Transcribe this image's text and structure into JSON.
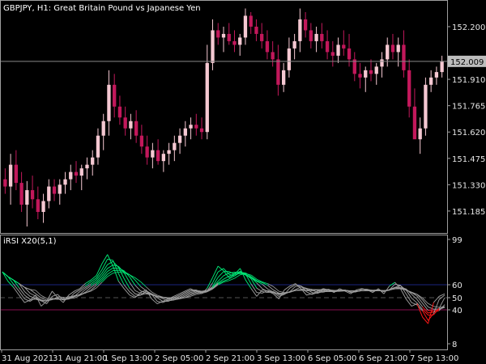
{
  "chart_data": [
    {
      "type": "candlestick",
      "title": "GBPJPY, H1:  Great Britain Pound vs Japanese Yen",
      "ylim": [
        151.1,
        152.32
      ],
      "y_ticks": [
        "152.200",
        "151.910",
        "151.765",
        "151.620",
        "151.475",
        "151.330",
        "151.185"
      ],
      "y_tick_values": [
        152.2,
        151.91,
        151.765,
        151.62,
        151.475,
        151.33,
        151.185
      ],
      "current_price": "152.009",
      "current_price_value": 152.009,
      "colors": {
        "bull": "#f5c8d2",
        "bear": "#c2185b",
        "price_line": "#888888",
        "price_label_bg": "#bdbdbd"
      },
      "candles": [
        [
          151.36,
          151.42,
          151.28,
          151.32
        ],
        [
          151.32,
          151.5,
          151.22,
          151.44
        ],
        [
          151.44,
          151.52,
          151.3,
          151.34
        ],
        [
          151.34,
          151.4,
          151.18,
          151.22
        ],
        [
          151.22,
          151.35,
          151.1,
          151.3
        ],
        [
          151.3,
          151.38,
          151.2,
          151.25
        ],
        [
          151.25,
          151.32,
          151.14,
          151.18
        ],
        [
          151.18,
          151.28,
          151.12,
          151.24
        ],
        [
          151.24,
          151.36,
          151.2,
          151.32
        ],
        [
          151.32,
          151.36,
          151.24,
          151.28
        ],
        [
          151.28,
          151.36,
          151.22,
          151.33
        ],
        [
          151.33,
          151.4,
          151.28,
          151.36
        ],
        [
          151.36,
          151.44,
          151.3,
          151.4
        ],
        [
          151.4,
          151.46,
          151.34,
          151.38
        ],
        [
          151.38,
          151.44,
          151.3,
          151.42
        ],
        [
          151.42,
          151.48,
          151.36,
          151.44
        ],
        [
          151.44,
          151.52,
          151.38,
          151.48
        ],
        [
          151.48,
          151.64,
          151.44,
          151.6
        ],
        [
          151.6,
          151.72,
          151.52,
          151.68
        ],
        [
          151.68,
          151.96,
          151.6,
          151.88
        ],
        [
          151.88,
          151.94,
          151.7,
          151.76
        ],
        [
          151.76,
          151.82,
          151.66,
          151.7
        ],
        [
          151.7,
          151.76,
          151.6,
          151.64
        ],
        [
          151.64,
          151.72,
          151.58,
          151.68
        ],
        [
          151.68,
          151.74,
          151.56,
          151.6
        ],
        [
          151.6,
          151.66,
          151.5,
          151.54
        ],
        [
          151.54,
          151.6,
          151.44,
          151.48
        ],
        [
          151.48,
          151.56,
          151.42,
          151.52
        ],
        [
          151.52,
          151.58,
          151.44,
          151.46
        ],
        [
          151.46,
          151.52,
          151.4,
          151.5
        ],
        [
          151.5,
          151.56,
          151.44,
          151.52
        ],
        [
          151.52,
          151.6,
          151.46,
          151.56
        ],
        [
          151.56,
          151.64,
          151.5,
          151.6
        ],
        [
          151.6,
          151.68,
          151.54,
          151.64
        ],
        [
          151.64,
          151.7,
          151.58,
          151.66
        ],
        [
          151.66,
          151.72,
          151.6,
          151.64
        ],
        [
          151.64,
          151.7,
          151.58,
          151.62
        ],
        [
          151.62,
          152.1,
          151.58,
          152.0
        ],
        [
          152.0,
          152.24,
          151.96,
          152.18
        ],
        [
          152.18,
          152.22,
          152.1,
          152.14
        ],
        [
          152.14,
          152.2,
          152.06,
          152.16
        ],
        [
          152.16,
          152.22,
          152.1,
          152.12
        ],
        [
          152.12,
          152.18,
          152.06,
          152.1
        ],
        [
          152.1,
          152.16,
          152.04,
          152.14
        ],
        [
          152.14,
          152.3,
          152.1,
          152.26
        ],
        [
          152.26,
          152.28,
          152.16,
          152.2
        ],
        [
          152.2,
          152.24,
          152.12,
          152.16
        ],
        [
          152.16,
          152.22,
          152.08,
          152.12
        ],
        [
          152.12,
          152.18,
          152.02,
          152.06
        ],
        [
          152.06,
          152.12,
          151.98,
          152.02
        ],
        [
          152.02,
          152.1,
          151.82,
          151.88
        ],
        [
          151.88,
          152.0,
          151.84,
          151.96
        ],
        [
          151.96,
          152.14,
          151.92,
          152.08
        ],
        [
          152.08,
          152.16,
          152.02,
          152.12
        ],
        [
          152.12,
          152.3,
          152.06,
          152.24
        ],
        [
          152.24,
          152.28,
          152.14,
          152.18
        ],
        [
          152.18,
          152.22,
          152.08,
          152.12
        ],
        [
          152.12,
          152.2,
          152.06,
          152.16
        ],
        [
          152.16,
          152.22,
          152.08,
          152.12
        ],
        [
          152.12,
          152.18,
          152.02,
          152.06
        ],
        [
          152.06,
          152.12,
          151.98,
          152.04
        ],
        [
          152.04,
          152.14,
          152.0,
          152.1
        ],
        [
          152.1,
          152.18,
          152.04,
          152.08
        ],
        [
          152.08,
          152.16,
          151.98,
          152.02
        ],
        [
          152.02,
          152.06,
          151.9,
          151.94
        ],
        [
          151.94,
          152.0,
          151.86,
          151.92
        ],
        [
          151.92,
          151.98,
          151.84,
          151.96
        ],
        [
          151.96,
          152.02,
          151.9,
          151.94
        ],
        [
          151.94,
          152.0,
          151.88,
          151.98
        ],
        [
          151.98,
          152.06,
          151.92,
          152.02
        ],
        [
          152.02,
          152.14,
          151.98,
          152.1
        ],
        [
          152.1,
          152.16,
          152.02,
          152.06
        ],
        [
          152.06,
          152.14,
          151.98,
          152.1
        ],
        [
          152.1,
          152.18,
          151.92,
          151.96
        ],
        [
          151.96,
          152.02,
          151.7,
          151.76
        ],
        [
          151.76,
          151.86,
          151.64,
          151.58
        ],
        [
          151.58,
          151.7,
          151.5,
          151.64
        ],
        [
          151.64,
          151.92,
          151.6,
          151.88
        ],
        [
          151.88,
          151.96,
          151.84,
          151.92
        ],
        [
          151.92,
          151.98,
          151.88,
          151.95
        ],
        [
          151.95,
          152.04,
          151.92,
          152.01
        ]
      ]
    },
    {
      "type": "line",
      "title": "iRSI X20(5,1)",
      "ylim": [
        0,
        100
      ],
      "y_ticks": [
        "99",
        "60",
        "50",
        "40",
        "8"
      ],
      "y_tick_values": [
        99,
        60,
        50,
        40,
        8
      ],
      "levels": [
        60,
        50,
        40
      ],
      "colors": {
        "above": "#00e676",
        "below": "#ff1a1a",
        "neutral": "#9e9e9e",
        "level_upper": "#1a237e",
        "level_lower": "#880e4f",
        "level_mid": "#555555"
      },
      "series_count": 20,
      "x_labels": [
        "31 Aug 2021",
        "31 Aug 21:00",
        "1 Sep 13:00",
        "2 Sep 05:00",
        "2 Sep 21:00",
        "3 Sep 13:00",
        "6 Sep 05:00",
        "6 Sep 21:00",
        "7 Sep 13:00"
      ],
      "values": [
        71,
        63,
        58,
        52,
        46,
        48,
        52,
        43,
        47,
        55,
        50,
        46,
        52,
        55,
        57,
        61,
        64,
        68,
        78,
        86,
        76,
        63,
        57,
        52,
        50,
        54,
        56,
        49,
        45,
        47,
        49,
        51,
        53,
        55,
        57,
        55,
        53,
        57,
        66,
        76,
        72,
        66,
        69,
        74,
        64,
        57,
        51,
        56,
        55,
        53,
        49,
        56,
        59,
        61,
        57,
        52,
        53,
        55,
        57,
        56,
        54,
        57,
        55,
        53,
        56,
        57,
        56,
        54,
        57,
        53,
        59,
        62,
        57,
        49,
        43,
        45,
        33,
        27,
        46,
        51,
        53
      ]
    }
  ]
}
